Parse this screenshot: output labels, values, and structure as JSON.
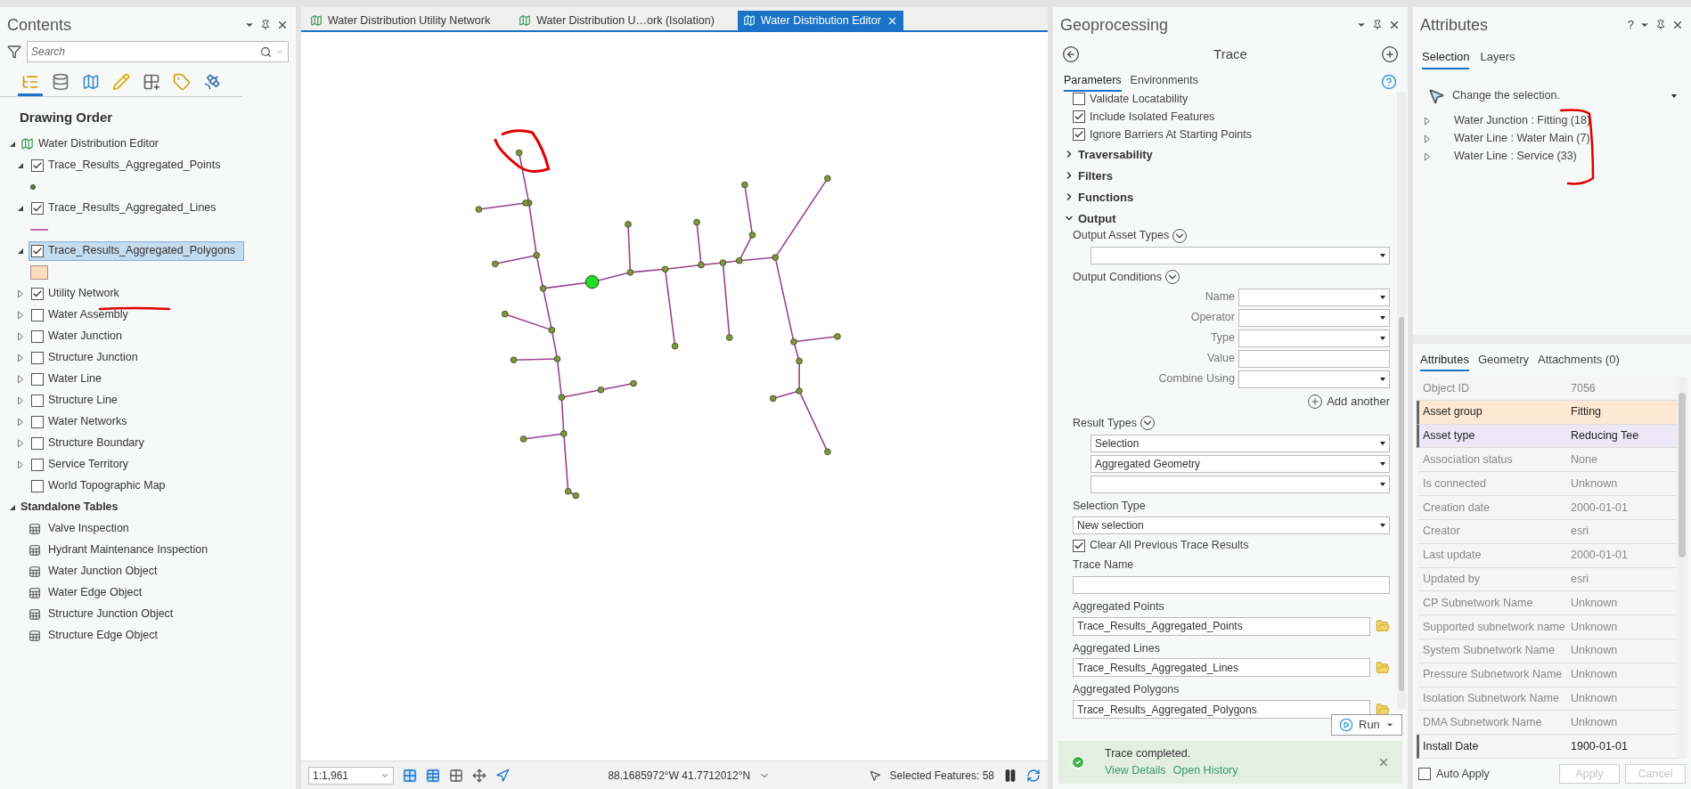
{
  "contents": {
    "title": "Contents",
    "search": {
      "placeholder": "Search"
    },
    "toolbar": [
      {
        "kind": "tree",
        "selected": true
      },
      {
        "kind": "database",
        "selected": false
      },
      {
        "kind": "map",
        "selected": false
      },
      {
        "kind": "pencil",
        "selected": false
      },
      {
        "kind": "grid",
        "selected": false
      },
      {
        "kind": "tag",
        "selected": false
      },
      {
        "kind": "satellite",
        "selected": false
      }
    ],
    "heading": "Drawing Order",
    "map": {
      "label": "Water Distribution Editor",
      "expanded": true,
      "layers": [
        {
          "label": "Trace_Results_Aggregated_Points",
          "checked": true,
          "expanded": true,
          "selected": false,
          "kind": "point"
        },
        {
          "label": "Trace_Results_Aggregated_Lines",
          "checked": true,
          "expanded": true,
          "selected": false,
          "kind": "line"
        },
        {
          "label": "Trace_Results_Aggregated_Polygons",
          "checked": true,
          "expanded": true,
          "selected": true,
          "kind": "polygon"
        },
        {
          "label": "Utility Network",
          "checked": true,
          "expanded": false,
          "selected": false,
          "kind": "layer"
        },
        {
          "label": "Water Assembly",
          "checked": false,
          "expanded": false,
          "selected": false,
          "kind": "layer"
        },
        {
          "label": "Water Junction",
          "checked": false,
          "expanded": false,
          "selected": false,
          "kind": "layer"
        },
        {
          "label": "Structure Junction",
          "checked": false,
          "expanded": false,
          "selected": false,
          "kind": "layer"
        },
        {
          "label": "Water Line",
          "checked": false,
          "expanded": false,
          "selected": false,
          "kind": "layer"
        },
        {
          "label": "Structure Line",
          "checked": false,
          "expanded": false,
          "selected": false,
          "kind": "layer"
        },
        {
          "label": "Water Networks",
          "checked": false,
          "expanded": false,
          "selected": false,
          "kind": "layer"
        },
        {
          "label": "Structure Boundary",
          "checked": false,
          "expanded": false,
          "selected": false,
          "kind": "layer"
        },
        {
          "label": "Service Territory",
          "checked": false,
          "expanded": false,
          "selected": false,
          "kind": "layer"
        },
        {
          "label": "World Topographic Map",
          "checked": false,
          "selected": false,
          "kind": "basemap"
        }
      ]
    },
    "tables_group": {
      "label": "Standalone Tables",
      "expanded": true,
      "tables": [
        "Valve Inspection",
        "Hydrant Maintenance Inspection",
        "Water Junction Object",
        "Water Edge Object",
        "Structure Junction Object",
        "Structure Edge Object"
      ]
    }
  },
  "map_view": {
    "tabs": [
      {
        "label": "Water Distribution Utility Network",
        "selected": false
      },
      {
        "label": "Water Distribution U…ork (Isolation)",
        "selected": false
      },
      {
        "label": "Water Distribution Editor",
        "selected": true
      }
    ],
    "status_bar": {
      "scale": "1:1,961",
      "coordinates": "88.1685972°W 41.7712012°N",
      "selected_features": "Selected Features: 58"
    }
  },
  "geoprocessing": {
    "title": "Geoprocessing",
    "tool": "Trace",
    "tabs": [
      {
        "label": "Parameters",
        "selected": true
      },
      {
        "label": "Environments",
        "selected": false
      }
    ],
    "options": [
      {
        "label": "Validate Locatability",
        "checked": false
      },
      {
        "label": "Include Isolated Features",
        "checked": true
      },
      {
        "label": "Ignore Barriers At Starting Points",
        "checked": true
      }
    ],
    "sections": [
      {
        "label": "Traversability",
        "expanded": false
      },
      {
        "label": "Filters",
        "expanded": false
      },
      {
        "label": "Functions",
        "expanded": false
      },
      {
        "label": "Output",
        "expanded": true
      }
    ],
    "output": {
      "asset_types_label": "Output Asset Types",
      "conditions_label": "Output Conditions",
      "conditions": [
        {
          "label": "Name",
          "kind": "dropdown"
        },
        {
          "label": "Operator",
          "kind": "dropdown"
        },
        {
          "label": "Type",
          "kind": "dropdown"
        },
        {
          "label": "Value",
          "kind": "text"
        },
        {
          "label": "Combine Using",
          "kind": "dropdown"
        }
      ],
      "add_another": "Add another",
      "result_types_label": "Result Types",
      "result_types": [
        "Selection",
        "Aggregated Geometry"
      ],
      "selection_type_label": "Selection Type",
      "selection_type": "New selection",
      "clear_previous": {
        "label": "Clear All Previous Trace Results",
        "checked": true
      },
      "trace_name_label": "Trace Name",
      "outputs": [
        {
          "label": "Aggregated Points",
          "value": "Trace_Results_Aggregated_Points"
        },
        {
          "label": "Aggregated Lines",
          "value": "Trace_Results_Aggregated_Lines"
        },
        {
          "label": "Aggregated Polygons",
          "value": "Trace_Results_Aggregated_Polygons"
        }
      ]
    },
    "run": "Run",
    "message": {
      "text": "Trace completed.",
      "links": [
        "View Details",
        "Open History"
      ]
    }
  },
  "attributes": {
    "title": "Attributes",
    "help": "?",
    "tabs": [
      {
        "label": "Selection",
        "selected": true
      },
      {
        "label": "Layers",
        "selected": false
      }
    ],
    "change_selection": "Change the selection.",
    "selection_tree": [
      {
        "label": "Water Junction : Fitting (18)",
        "expanded": false
      },
      {
        "label": "Water Line : Water Main (7)",
        "expanded": false
      },
      {
        "label": "Water Line : Service (33)",
        "expanded": false
      }
    ],
    "detail_tabs": [
      {
        "label": "Attributes",
        "selected": true
      },
      {
        "label": "Geometry",
        "selected": false
      },
      {
        "label": "Attachments (0)",
        "selected": false
      }
    ],
    "rows": [
      {
        "field": "Object ID",
        "value": "7056",
        "edited": false
      },
      {
        "field": "Asset group",
        "value": "Fitting",
        "color": "#fde9d3",
        "edited": true
      },
      {
        "field": "Asset type",
        "value": "Reducing Tee",
        "color": "#ece8f6",
        "edited": true
      },
      {
        "field": "Association status",
        "value": "None",
        "edited": false
      },
      {
        "field": "Is connected",
        "value": "Unknown",
        "edited": false
      },
      {
        "field": "Creation date",
        "value": "2000-01-01",
        "edited": false
      },
      {
        "field": "Creator",
        "value": "esri",
        "edited": false
      },
      {
        "field": "Last update",
        "value": "2000-01-01",
        "edited": false
      },
      {
        "field": "Updated by",
        "value": "esri",
        "edited": false
      },
      {
        "field": "CP Subnetwork Name",
        "value": "Unknown",
        "edited": false
      },
      {
        "field": "Supported subnetwork name",
        "value": "Unknown",
        "edited": false
      },
      {
        "field": "System Subnetwork Name",
        "value": "Unknown",
        "edited": false
      },
      {
        "field": "Pressure Subnetwork Name",
        "value": "Unknown",
        "edited": false
      },
      {
        "field": "Isolation Subnetwork Name",
        "value": "Unknown",
        "edited": false
      },
      {
        "field": "DMA Subnetwork Name",
        "value": "Unknown",
        "edited": false
      },
      {
        "field": "Install Date",
        "value": "1900-01-01",
        "edited": true
      }
    ],
    "auto_apply": {
      "label": "Auto Apply",
      "checked": false
    },
    "buttons": [
      {
        "label": "Apply",
        "disabled": true
      },
      {
        "label": "Cancel",
        "disabled": true
      }
    ]
  }
}
